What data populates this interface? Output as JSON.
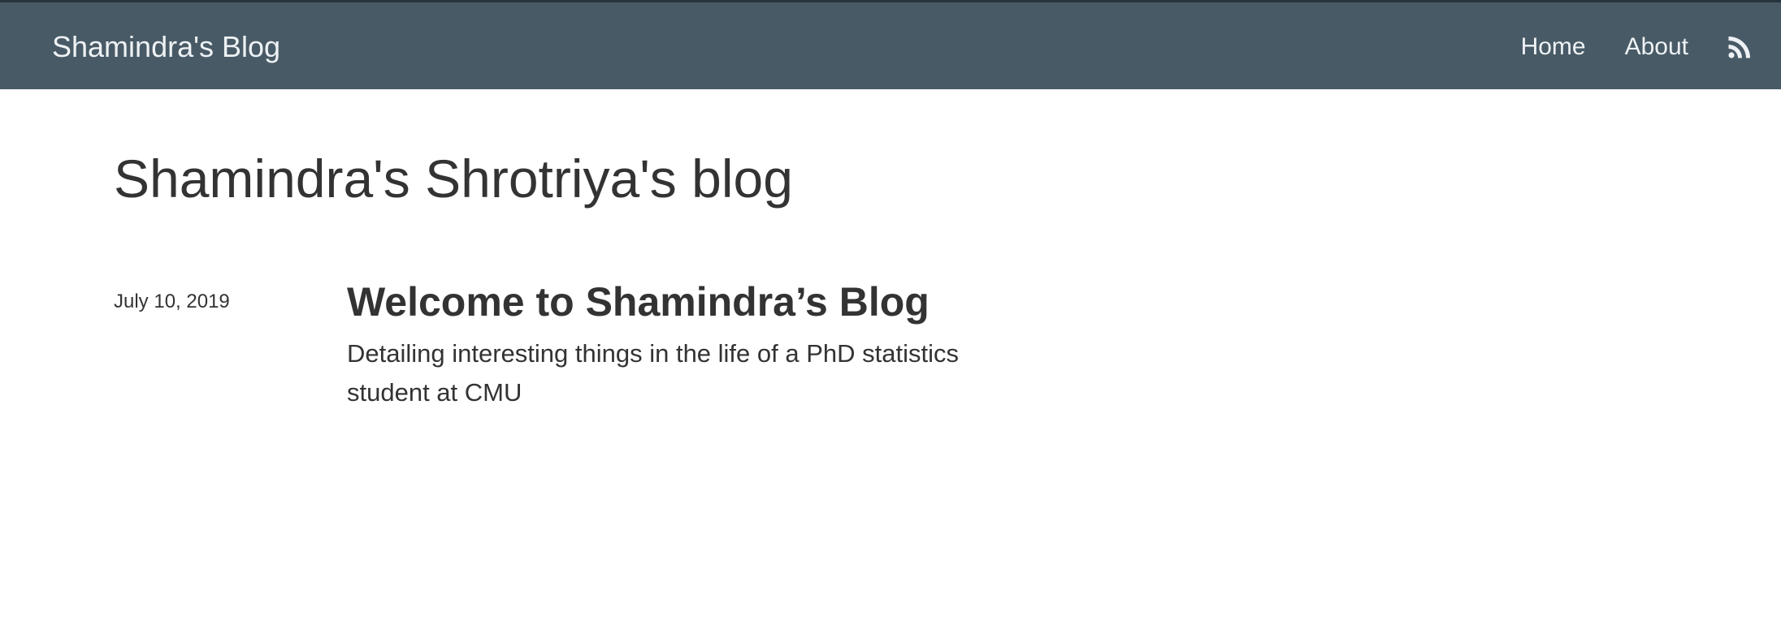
{
  "navbar": {
    "brand": "Shamindra's Blog",
    "links": [
      {
        "label": "Home"
      },
      {
        "label": "About"
      }
    ],
    "rss_icon": "rss-icon",
    "background_color": "#485a66",
    "text_color": "#eef2f4"
  },
  "main": {
    "title": "Shamindra's Shrotriya's blog",
    "posts": [
      {
        "date": "July 10, 2019",
        "title": "Welcome to Shamindra’s Blog",
        "summary": "Detailing interesting things in the life of a PhD statistics student at CMU"
      }
    ]
  }
}
